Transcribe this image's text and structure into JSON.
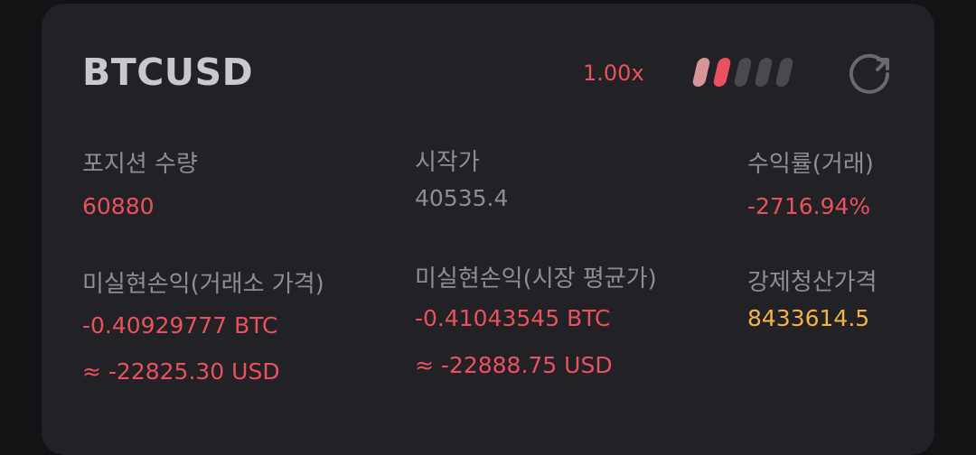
{
  "header": {
    "symbol": "BTCUSD",
    "leverage": "1.00x",
    "risk_level": {
      "filled": 2,
      "total": 5
    }
  },
  "stats": {
    "position_qty": {
      "label": "포지션 수량",
      "value": "60880"
    },
    "entry_price": {
      "label": "시작가",
      "value": "40535.4"
    },
    "roi": {
      "label": "수익률(거래)",
      "value": "-2716.94%"
    },
    "unrealized_pnl_exchange": {
      "label": "미실현손익(거래소 가격)",
      "value_btc": "-0.40929777 BTC",
      "value_usd": "≈ -22825.30 USD"
    },
    "unrealized_pnl_market": {
      "label": "미실현손익(시장 평균가)",
      "value_btc": "-0.41043545 BTC",
      "value_usd": "≈ -22888.75 USD"
    },
    "liquidation_price": {
      "label": "강제청산가격",
      "value": "8433614.5"
    }
  },
  "colors": {
    "negative": "#e8515d",
    "warning": "#f2b345",
    "muted": "#8e8e92",
    "card": "#222226",
    "background": "#131316",
    "risk_filled": [
      "#d8949b",
      "#e8515d"
    ],
    "risk_empty": "#4a4a4e"
  },
  "icons": {
    "refresh": "refresh-icon"
  }
}
